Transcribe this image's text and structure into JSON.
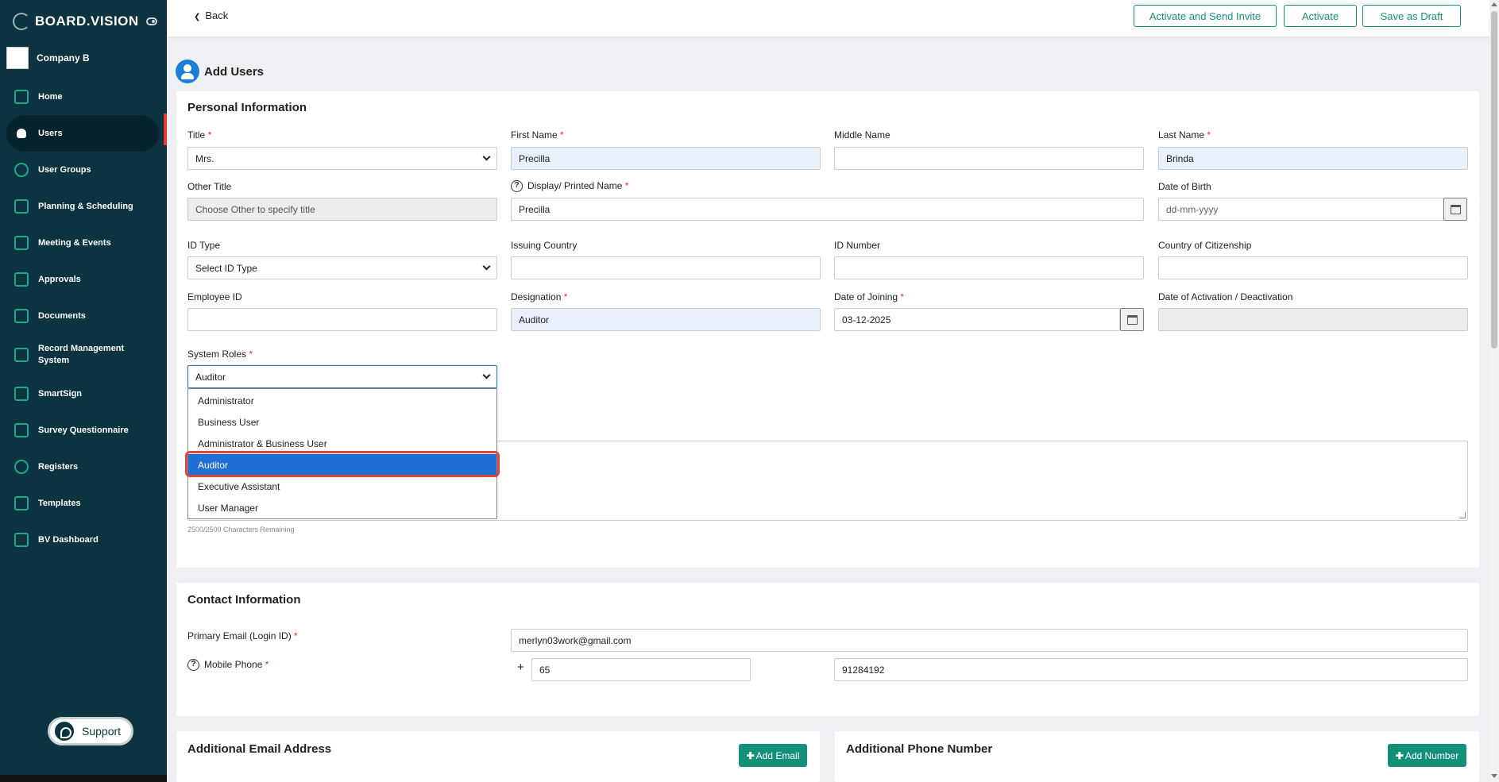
{
  "sidebar": {
    "brand": "BOARD.VISION",
    "company": "Company B",
    "items": [
      {
        "label": "Home"
      },
      {
        "label": "Users"
      },
      {
        "label": "User Groups"
      },
      {
        "label": "Planning & Scheduling"
      },
      {
        "label": "Meeting & Events"
      },
      {
        "label": "Approvals"
      },
      {
        "label": "Documents"
      },
      {
        "label": "Record Management System"
      },
      {
        "label": "SmartSign"
      },
      {
        "label": "Survey Questionnaire"
      },
      {
        "label": "Registers"
      },
      {
        "label": "Templates"
      },
      {
        "label": "BV Dashboard"
      }
    ],
    "support": "Support"
  },
  "topbar": {
    "back": "Back",
    "activate_send": "Activate and Send Invite",
    "activate": "Activate",
    "save_draft": "Save as Draft"
  },
  "page": {
    "title": "Add Users"
  },
  "personal": {
    "heading": "Personal Information",
    "title_label": "Title",
    "title_value": "Mrs.",
    "first_name_label": "First Name",
    "first_name_value": "Precilla",
    "middle_name_label": "Middle Name",
    "middle_name_value": "",
    "last_name_label": "Last Name",
    "last_name_value": "Brinda",
    "other_title_label": "Other Title",
    "other_title_placeholder": "Choose Other to specify title",
    "display_name_label": "Display/ Printed Name",
    "display_name_value": "Precilla",
    "dob_label": "Date of Birth",
    "dob_placeholder": "dd-mm-yyyy",
    "id_type_label": "ID Type",
    "id_type_value": "Select ID Type",
    "issuing_country_label": "Issuing Country",
    "id_number_label": "ID Number",
    "citizenship_label": "Country of Citizenship",
    "employee_id_label": "Employee ID",
    "designation_label": "Designation",
    "designation_value": "Auditor",
    "doj_label": "Date of Joining",
    "doj_value": "03-12-2025",
    "activation_label": "Date of Activation / Deactivation",
    "roles_label": "System Roles",
    "roles_value": "Auditor",
    "roles_options": [
      "Administrator",
      "Business User",
      "Administrator & Business User",
      "Auditor",
      "Executive Assistant",
      "User Manager"
    ],
    "char_remaining": "2500/2500 Characters Remaining"
  },
  "contact": {
    "heading": "Contact Information",
    "email_label": "Primary Email (Login ID)",
    "email_value": "merlyn03work@gmail.com",
    "mobile_label": "Mobile Phone",
    "country_code": "65",
    "mobile_value": "91284192",
    "plus": "+"
  },
  "additional": {
    "email_heading": "Additional Email Address",
    "add_email": "Add Email",
    "phone_heading": "Additional Phone Number",
    "add_number": "Add Number"
  },
  "colors": {
    "sidebar_bg": "#0c3340",
    "accent": "#12907a",
    "selected": "#1f6fd6",
    "highlight": "#e0453a"
  }
}
